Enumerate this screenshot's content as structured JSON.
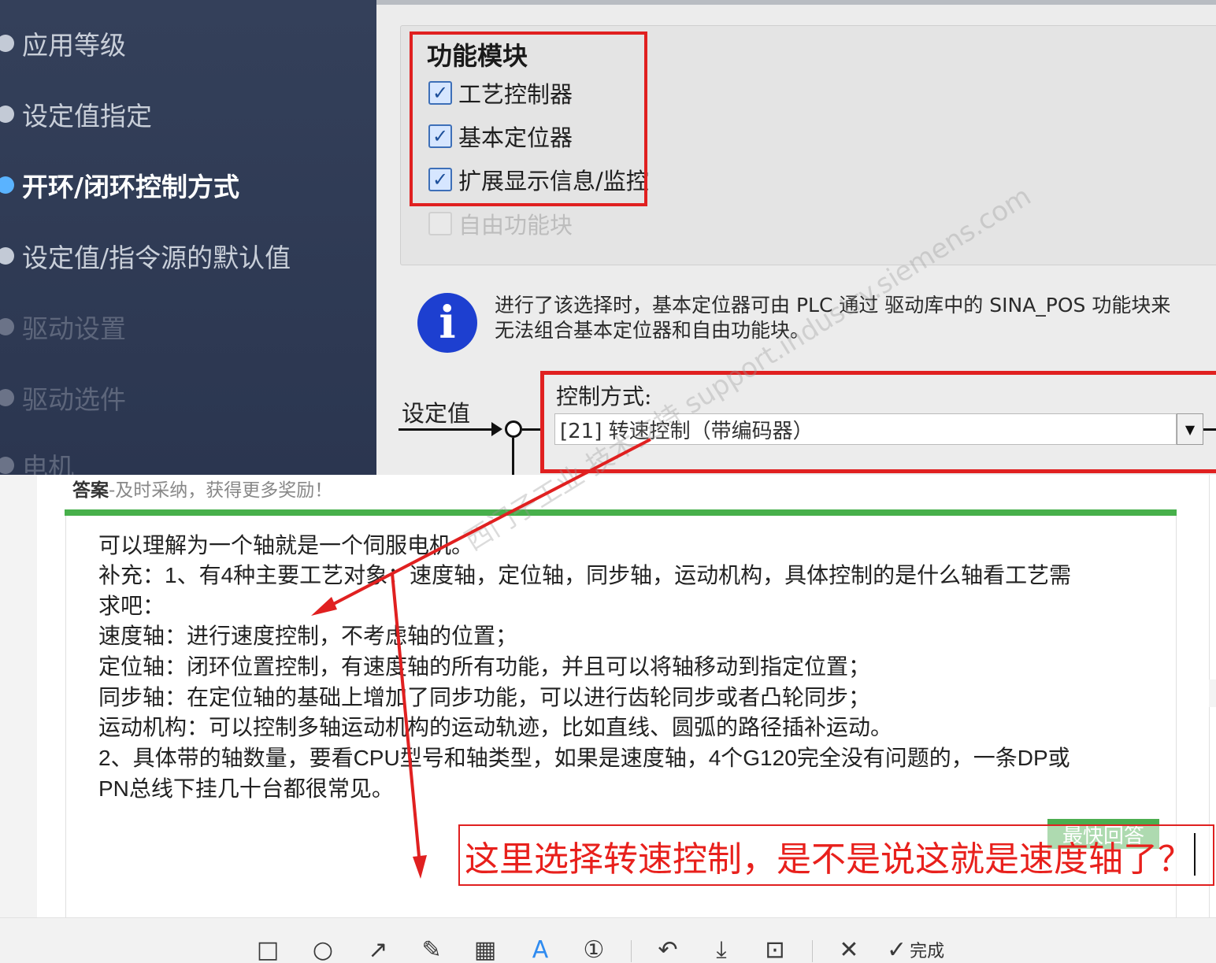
{
  "wizard": {
    "nav_items": [
      {
        "label": "应用等级",
        "state": "done"
      },
      {
        "label": "设定值指定",
        "state": "done"
      },
      {
        "label": "开环/闭环控制方式",
        "state": "active"
      },
      {
        "label": "设定值/指令源的默认值",
        "state": "done"
      },
      {
        "label": "驱动设置",
        "state": "pending"
      },
      {
        "label": "驱动选件",
        "state": "pending"
      },
      {
        "label": "电机",
        "state": "pending"
      }
    ],
    "function_modules": {
      "title": "功能模块",
      "options": [
        {
          "label": "工艺控制器",
          "checked": true,
          "enabled": true
        },
        {
          "label": "基本定位器",
          "checked": true,
          "enabled": true
        },
        {
          "label": "扩展显示信息/监控",
          "checked": true,
          "enabled": true
        },
        {
          "label": "自由功能块",
          "checked": false,
          "enabled": false
        }
      ]
    },
    "info": {
      "line1": "进行了该选择时，基本定位器可由 PLC 通过 驱动库中的 SINA_POS 功能块来",
      "line2": "无法组合基本定位器和自由功能块。"
    },
    "setpoint_label": "设定值",
    "control_mode": {
      "label": "控制方式:",
      "selected": "[21] 转速控制（带编码器）"
    },
    "watermark": "西门子工业 技术支持 support.industry.siemens.com"
  },
  "answer": {
    "header_bold": "答案",
    "header_rest": "-及时采纳，获得更多奖励！",
    "lines": [
      "可以理解为一个轴就是一个伺服电机。",
      "补充：1、有4种主要工艺对象：速度轴，定位轴，同步轴，运动机构，具体控制的是什么轴看工艺需",
      "求吧：",
      "速度轴：进行速度控制，不考虑轴的位置；",
      "定位轴：闭环位置控制，有速度轴的所有功能，并且可以将轴移动到指定位置；",
      "同步轴：在定位轴的基础上增加了同步功能，可以进行齿轮同步或者凸轮同步；",
      "运动机构：可以控制多轴运动机构的运动轨迹，比如直线、圆弧的路径插补运动。",
      "2、具体带的轴数量，要看CPU型号和轴类型，如果是速度轴，4个G120完全没有问题的，一条DP或",
      "PN总线下挂几十台都很常见。"
    ],
    "fastest_badge": "最快回答"
  },
  "annotation": {
    "question": "这里选择转速控制，是不是说这就是速度轴了？",
    "color": "#e8201c"
  },
  "toolbar": {
    "tools": [
      {
        "name": "rectangle-tool",
        "glyph": "□"
      },
      {
        "name": "ellipse-tool",
        "glyph": "○"
      },
      {
        "name": "arrow-tool",
        "glyph": "↗"
      },
      {
        "name": "pen-tool",
        "glyph": "✎"
      },
      {
        "name": "mosaic-tool",
        "glyph": "▦"
      },
      {
        "name": "text-tool",
        "glyph": "A"
      },
      {
        "name": "number-tool",
        "glyph": "①"
      },
      {
        "name": "undo-tool",
        "glyph": "↶"
      },
      {
        "name": "download-tool",
        "glyph": "⤓"
      },
      {
        "name": "pin-tool",
        "glyph": "⊡"
      },
      {
        "name": "close-tool",
        "glyph": "✕"
      },
      {
        "name": "done-tool",
        "glyph": "✓"
      }
    ],
    "done_label": "完成",
    "active_color": "#2f8bf0"
  }
}
